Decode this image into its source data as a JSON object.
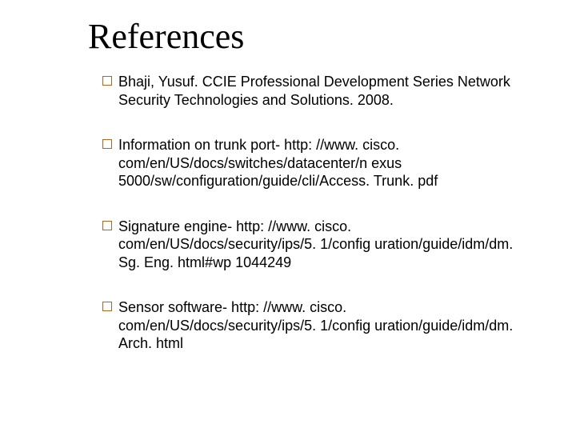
{
  "title": "References",
  "refs": [
    "Bhaji, Yusuf. CCIE Professional Development Series Network Security Technologies and Solutions. 2008.",
    "Information on trunk port- http: //www. cisco. com/en/US/docs/switches/datacenter/n exus 5000/sw/configuration/guide/cli/Access. Trunk. pdf",
    "Signature engine- http: //www. cisco. com/en/US/docs/security/ips/5. 1/config uration/guide/idm/dm. Sg. Eng. html#wp 1044249",
    "Sensor software- http: //www. cisco. com/en/US/docs/security/ips/5. 1/config uration/guide/idm/dm. Arch. html"
  ]
}
